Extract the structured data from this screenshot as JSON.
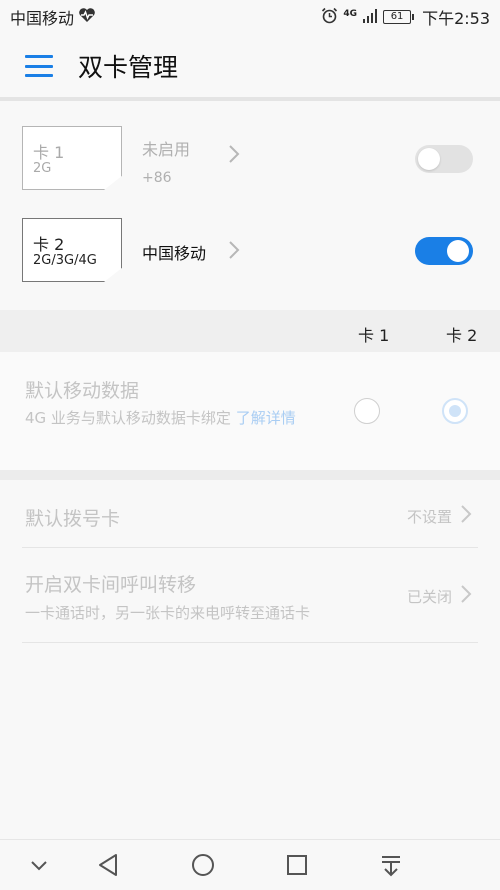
{
  "status_bar": {
    "carrier": "中国移动",
    "network": "4G",
    "battery": "61",
    "time": "下午2:53"
  },
  "app_bar": {
    "title": "双卡管理"
  },
  "sims": [
    {
      "slot": "卡 1",
      "tech": "2G",
      "name": "未启用",
      "sub": "+86",
      "enabled": false
    },
    {
      "slot": "卡 2",
      "tech": "2G/3G/4G",
      "name": "中国移动",
      "sub": "",
      "enabled": true
    }
  ],
  "columns": {
    "col1": "卡 1",
    "col2": "卡 2"
  },
  "default_data": {
    "title": "默认移动数据",
    "desc": "4G 业务与默认移动数据卡绑定",
    "link": "了解详情",
    "selected": "卡 2"
  },
  "default_dial": {
    "title": "默认拨号卡",
    "value": "不设置"
  },
  "call_forward": {
    "title": "开启双卡间呼叫转移",
    "sub": "一卡通话时，另一张卡的来电呼转至通话卡",
    "value": "已关闭"
  },
  "colors": {
    "accent": "#1a7fe6"
  },
  "icons": [
    "heart-pulse-icon",
    "alarm-icon",
    "signal-icon",
    "battery-icon",
    "menu-icon",
    "chevron-right-icon",
    "nav-down-icon",
    "nav-back-icon",
    "nav-home-icon",
    "nav-recents-icon",
    "nav-notification-icon"
  ]
}
